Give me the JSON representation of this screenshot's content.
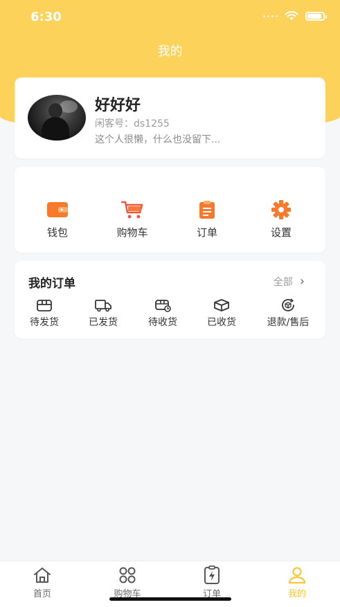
{
  "status_bar": {
    "time": "6:30",
    "battery_level": 0.92
  },
  "header": {
    "title": "我的"
  },
  "profile": {
    "nickname": "好好好",
    "account_id": "闲客号：ds1255",
    "bio": "这个人很懒，什么也没留下..."
  },
  "quick_actions": [
    {
      "label": "钱包",
      "icon": "wallet-icon"
    },
    {
      "label": "购物车",
      "icon": "cart-icon"
    },
    {
      "label": "订单",
      "icon": "clipboard-icon"
    },
    {
      "label": "设置",
      "icon": "gear-icon"
    }
  ],
  "orders": {
    "title": "我的订单",
    "all_label": "全部",
    "items": [
      {
        "label": "待发货",
        "icon": "package-icon"
      },
      {
        "label": "已发货",
        "icon": "truck-icon"
      },
      {
        "label": "待收货",
        "icon": "delivery-icon"
      },
      {
        "label": "已收货",
        "icon": "open-box-icon"
      },
      {
        "label": "退款/售后",
        "icon": "refund-icon"
      }
    ]
  },
  "tabbar": {
    "tabs": [
      {
        "label": "首页",
        "icon": "home-icon",
        "active": false
      },
      {
        "label": "购物车",
        "icon": "grid-icon",
        "active": false
      },
      {
        "label": "订单",
        "icon": "order-bolt-icon",
        "active": false
      },
      {
        "label": "我的",
        "icon": "user-icon",
        "active": true
      }
    ]
  },
  "colors": {
    "header": "#fdd25a",
    "accent_orange": "#f7792b",
    "active_tab": "#f6c638"
  }
}
